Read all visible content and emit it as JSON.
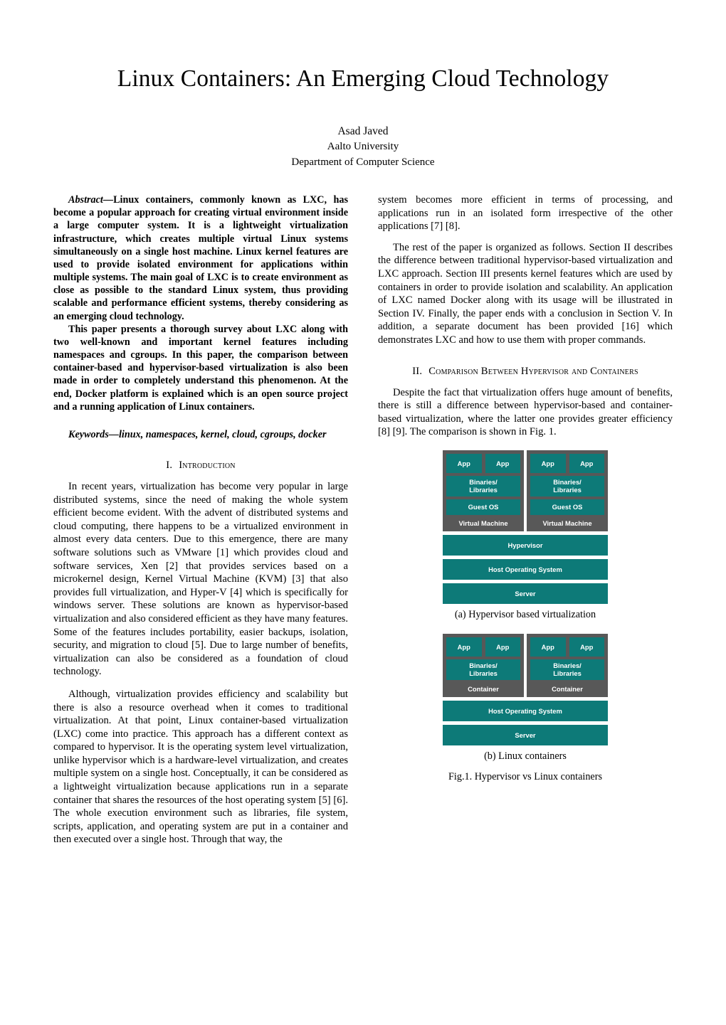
{
  "paper": {
    "title": "Linux Containers: An Emerging Cloud Technology",
    "author": "Asad Javed",
    "affiliation": "Aalto University",
    "department": "Department of Computer Science"
  },
  "abstract": {
    "label": "Abstract—",
    "para1": "Linux containers, commonly known as LXC, has become a popular approach for creating virtual environment inside a large computer system. It is a lightweight virtualization infrastructure, which creates multiple virtual Linux systems simultaneously on a single host machine. Linux kernel features are used to provide isolated environment for applications within multiple systems. The main goal of LXC is to create environment as close as possible to the standard Linux system, thus providing scalable and performance efficient systems, thereby considering as an emerging cloud technology.",
    "para2": "This paper presents a thorough survey about LXC along with two well-known and important kernel features including namespaces and cgroups. In this paper, the comparison between container-based and hypervisor-based virtualization is also been made in order to completely understand this phenomenon. At the end, Docker platform is explained which is an open source project and a running application of Linux containers.",
    "keywords": "Keywords—linux, namespaces, kernel, cloud, cgroups, docker"
  },
  "sections": {
    "intro": {
      "numeral": "I.",
      "title": "Introduction",
      "para1": "In recent years, virtualization has become very popular in large distributed systems, since the need of making the whole system efficient become evident. With the advent of distributed systems and cloud computing, there happens to be a virtualized environment in almost every data centers. Due to this emergence, there are many software solutions such as VMware [1] which provides cloud and software services, Xen [2] that provides services based on a microkernel design, Kernel Virtual Machine (KVM) [3] that also provides full virtualization, and Hyper-V [4] which is specifically for windows server. These solutions are known as hypervisor-based virtualization and also considered efficient as they have many features. Some of the features includes portability, easier backups, isolation, security, and migration to cloud [5]. Due to large number of benefits, virtualization can also be considered as a foundation of cloud technology.",
      "para2": "Although, virtualization provides efficiency and scalability but there is also a resource overhead when it comes to traditional virtualization. At that point, Linux container-based virtualization (LXC) come into practice. This approach has a different context as compared to hypervisor. It is the operating system level virtualization, unlike hypervisor which is a hardware-level virtualization, and creates multiple system on a single host. Conceptually, it can be considered as a lightweight virtualization because applications run in a separate container that shares the resources of the host operating system [5] [6]. The whole execution environment such as libraries, file system, scripts, application, and operating system are put in a container and then executed over a single host. Through that way, the",
      "para_cont": "system becomes more efficient in terms of processing, and applications run in an isolated form irrespective of the other applications [7] [8].",
      "para3": "The rest of the paper is organized as follows. Section II describes the difference between traditional hypervisor-based virtualization and LXC approach. Section III presents kernel features which are used by containers in order to provide isolation and scalability. An application of LXC named Docker along with its usage will be illustrated in Section IV. Finally, the paper ends with a conclusion in Section V. In addition, a separate document has been provided [16] which demonstrates LXC and how to use them with proper commands."
    },
    "comparison": {
      "numeral": "II.",
      "title": "Comparison Between Hypervisor and Containers",
      "para1": "Despite the fact that virtualization offers huge amount of benefits, there is still a difference between hypervisor-based and container-based virtualization, where the latter one provides greater efficiency [8] [9]. The comparison is shown in Fig. 1."
    }
  },
  "figure": {
    "colors": {
      "teal": "#0d7a78",
      "gray": "#585858",
      "text": "#ffffff"
    },
    "hypervisor": {
      "vms": [
        {
          "apps": [
            "App",
            "App"
          ],
          "binaries": "Binaries/\nLibraries",
          "guest_os": "Guest OS",
          "label": "Virtual Machine"
        },
        {
          "apps": [
            "App",
            "App"
          ],
          "binaries": "Binaries/\nLibraries",
          "guest_os": "Guest OS",
          "label": "Virtual Machine"
        }
      ],
      "layers": [
        "Hypervisor",
        "Host Operating System",
        "Server"
      ],
      "caption": "(a) Hypervisor based virtualization"
    },
    "containers": {
      "containers": [
        {
          "apps": [
            "App",
            "App"
          ],
          "binaries": "Binaries/\nLibraries",
          "label": "Container"
        },
        {
          "apps": [
            "App",
            "App"
          ],
          "binaries": "Binaries/\nLibraries",
          "label": "Container"
        }
      ],
      "layers": [
        "Host Operating System",
        "Server"
      ],
      "caption": "(b) Linux containers"
    },
    "main_caption": "Fig.1. Hypervisor vs Linux containers",
    "labels": {
      "app": "App",
      "binaries_line1": "Binaries/",
      "binaries_line2": "Libraries",
      "guest_os": "Guest OS",
      "virtual_machine": "Virtual Machine",
      "container": "Container",
      "hypervisor": "Hypervisor",
      "host_os": "Host Operating System",
      "server": "Server"
    }
  }
}
